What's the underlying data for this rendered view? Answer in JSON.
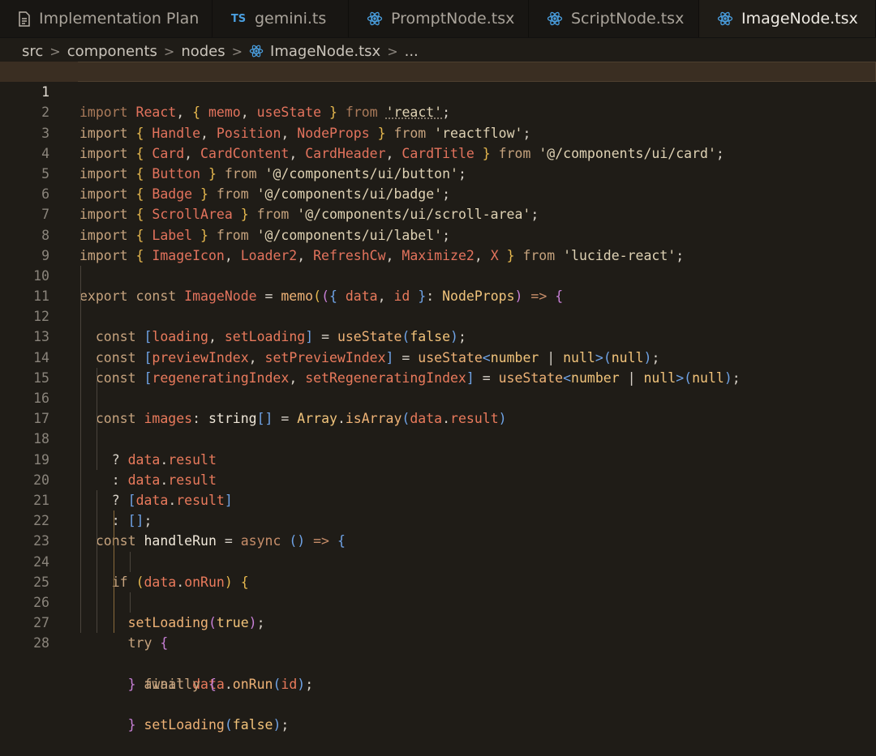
{
  "tabs": [
    {
      "label": "Implementation Plan",
      "icon": "document-icon",
      "active": false
    },
    {
      "label": "gemini.ts",
      "icon": "typescript-icon",
      "active": false
    },
    {
      "label": "PromptNode.tsx",
      "icon": "react-icon",
      "active": false
    },
    {
      "label": "ScriptNode.tsx",
      "icon": "react-icon",
      "active": false
    },
    {
      "label": "ImageNode.tsx",
      "icon": "react-icon",
      "active": true
    }
  ],
  "ts_badge": "TS",
  "close_glyph": "✕",
  "breadcrumb": {
    "parts": [
      "src",
      "components",
      "nodes",
      "ImageNode.tsx",
      "..."
    ],
    "separator": ">"
  },
  "colors": {
    "background": "#1f1c17",
    "tabbar": "#181613",
    "highlight_line": "#3a2e22",
    "accent_react": "#4a9fe0"
  },
  "code": {
    "current_line": 1,
    "lines": [
      {
        "n": "1"
      },
      {
        "n": "2"
      },
      {
        "n": "3"
      },
      {
        "n": "4"
      },
      {
        "n": "5"
      },
      {
        "n": "6"
      },
      {
        "n": "7"
      },
      {
        "n": "8"
      },
      {
        "n": "9"
      },
      {
        "n": "10"
      },
      {
        "n": "11"
      },
      {
        "n": "12"
      },
      {
        "n": "13"
      },
      {
        "n": "14"
      },
      {
        "n": "15"
      },
      {
        "n": "16"
      },
      {
        "n": "17"
      },
      {
        "n": "18"
      },
      {
        "n": "19"
      },
      {
        "n": "20"
      },
      {
        "n": "21"
      },
      {
        "n": "22"
      },
      {
        "n": "23"
      },
      {
        "n": "24"
      },
      {
        "n": "25"
      },
      {
        "n": "26"
      },
      {
        "n": "27"
      },
      {
        "n": "28"
      }
    ],
    "text": [
      "import React, { memo, useState } from 'react';",
      "import { Handle, Position, NodeProps } from 'reactflow';",
      "import { Card, CardContent, CardHeader, CardTitle } from '@/components/ui/card';",
      "import { Button } from '@/components/ui/button';",
      "import { Badge } from '@/components/ui/badge';",
      "import { ScrollArea } from '@/components/ui/scroll-area';",
      "import { Label } from '@/components/ui/label';",
      "import { ImageIcon, Loader2, RefreshCw, Maximize2, X } from 'lucide-react';",
      "",
      "export const ImageNode = memo(({ data, id }: NodeProps) => {",
      "  const [loading, setLoading] = useState(false);",
      "  const [previewIndex, setPreviewIndex] = useState<number | null>(null);",
      "  const [regeneratingIndex, setRegeneratingIndex] = useState<number | null>(null);",
      "",
      "  const images: string[] = Array.isArray(data.result)",
      "    ? data.result",
      "    : data.result",
      "    ? [data.result]",
      "    : [];",
      "",
      "  const handleRun = async () => {",
      "    if (data.onRun) {",
      "      setLoading(true);",
      "      try {",
      "        await data.onRun(id);",
      "      } finally {",
      "        setLoading(false);",
      "      }"
    ]
  }
}
